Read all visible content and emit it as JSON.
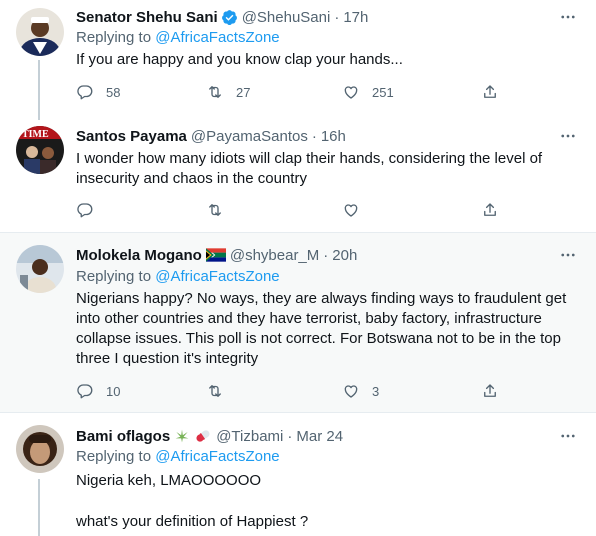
{
  "tweets": [
    {
      "name": "Senator Shehu Sani",
      "handle": "@ShehuSani",
      "time": "17h",
      "replying_prefix": "Replying to ",
      "replying_to": "@AfricaFactsZone",
      "text": "If you are happy and you know clap your hands...",
      "reply_count": "58",
      "retweet_count": "27",
      "like_count": "251"
    },
    {
      "name": "Santos Payama",
      "handle": "@PayamaSantos",
      "time": "16h",
      "text": "I wonder how many idiots will clap their hands, considering the level of insecurity and chaos in the country",
      "reply_count": "",
      "retweet_count": "",
      "like_count": ""
    },
    {
      "name": "Molokela Mogano",
      "handle": "@shybear_M",
      "time": "20h",
      "replying_prefix": "Replying to ",
      "replying_to": "@AfricaFactsZone",
      "text": "Nigerians happy? No ways, they are always finding ways to fraudulent get into other countries and they have terrorist, baby factory, infrastructure collapse issues. This poll is not correct. For Botswana not to be in the top three I question it's integrity",
      "reply_count": "10",
      "retweet_count": "",
      "like_count": "3"
    },
    {
      "name": "Bami oflagos",
      "handle": "@Tizbami",
      "time": "Mar 24",
      "replying_prefix": "Replying to ",
      "replying_to": "@AfricaFactsZone",
      "text_line1": "Nigeria keh, LMAOOOOOO",
      "text_line2": "what's your definition of Happiest ?"
    }
  ],
  "separator": "·",
  "colors": {
    "accent": "#1d9bf0",
    "muted": "#536471",
    "highlight_bg": "#f7f9f9"
  },
  "icons": [
    "verified-badge-icon",
    "more-icon",
    "reply-icon",
    "retweet-icon",
    "like-icon",
    "share-icon",
    "south-africa-flag-icon",
    "leaf-emoji-icon",
    "pill-emoji-icon"
  ]
}
